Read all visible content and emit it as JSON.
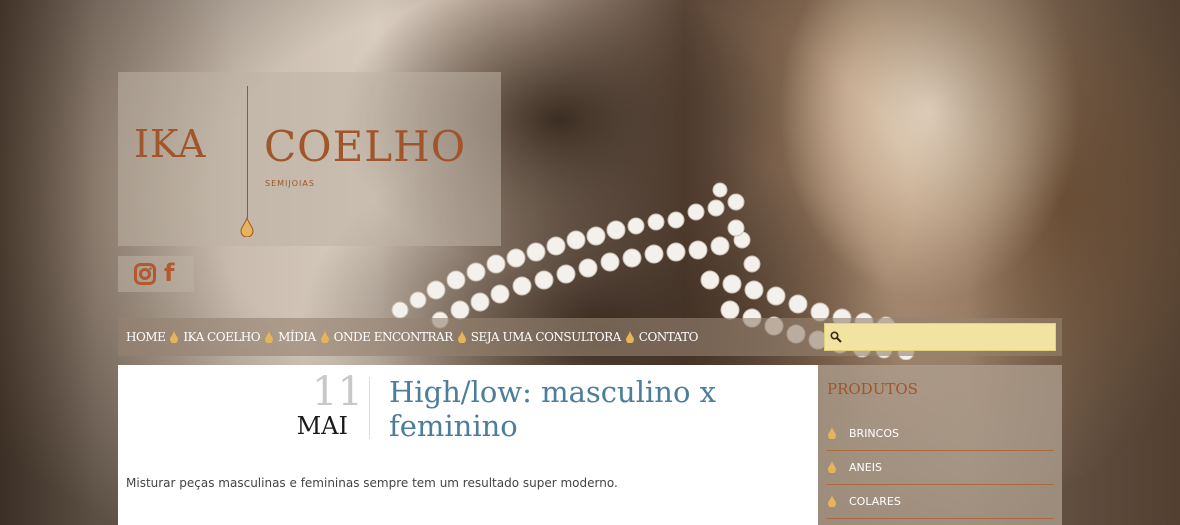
{
  "brand": {
    "name_left": "IKA",
    "name_right": "COELHO",
    "tagline": "SEMIJOIAS"
  },
  "social": {
    "icons": [
      "instagram-icon",
      "facebook-icon"
    ]
  },
  "nav": {
    "items": [
      "HOME",
      "IKA COELHO",
      "MÍDIA",
      "ONDE ENCONTRAR",
      "SEJA UMA CONSULTORA",
      "CONTATO"
    ],
    "separator_icon": "drop-icon"
  },
  "search": {
    "placeholder": "",
    "value": ""
  },
  "post": {
    "day": "11",
    "month": "MAI",
    "title": "High/low: masculino x feminino",
    "excerpt": "Misturar peças masculinas e femininas sempre tem um resultado super moderno."
  },
  "sidebar": {
    "title": "PRODUTOS",
    "items": [
      "BRINCOS",
      "ANEIS",
      "COLARES"
    ]
  },
  "colors": {
    "accent": "#a0552a",
    "title_blue": "#4b7e9b",
    "search_bg": "#f3e3a1",
    "drop_gold": "#e6b45a"
  }
}
